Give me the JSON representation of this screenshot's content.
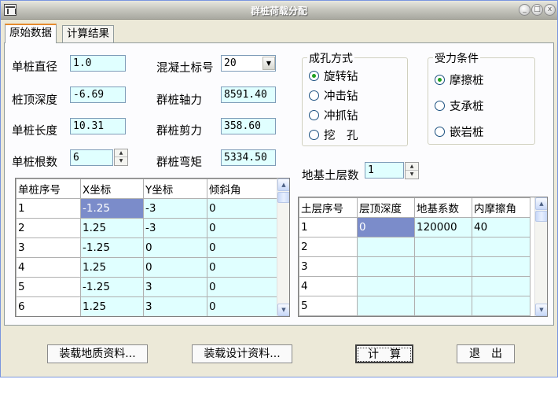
{
  "window": {
    "title": "群桩荷载分配",
    "controls": [
      "_",
      "□",
      "x"
    ]
  },
  "tabs": [
    {
      "label": "原始数据",
      "active": true
    },
    {
      "label": "计算结果",
      "active": false
    }
  ],
  "pile": {
    "diameter_label": "单桩直径",
    "diameter": "1.0",
    "top_depth_label": "桩顶深度",
    "top_depth": "-6.69",
    "length_label": "单桩长度",
    "length": "10.31",
    "count_label": "单桩根数",
    "count": "6"
  },
  "group": {
    "concrete_label": "混凝土标号",
    "concrete": "20",
    "axial_label": "群桩轴力",
    "axial": "8591.40",
    "shear_label": "群桩剪力",
    "shear": "358.60",
    "moment_label": "群桩弯矩",
    "moment": "5334.50"
  },
  "hole_method": {
    "title": "成孔方式",
    "options": [
      "旋转钻",
      "冲击钻",
      "冲抓钻",
      "挖　孔"
    ],
    "selected": 0
  },
  "load_condition": {
    "title": "受力条件",
    "options": [
      "摩擦桩",
      "支承桩",
      "嵌岩桩"
    ],
    "selected": 0
  },
  "soil": {
    "layers_label": "地基土层数",
    "layers": "1"
  },
  "pile_table": {
    "headers": [
      "单桩序号",
      "X坐标",
      "Y坐标",
      "倾斜角"
    ],
    "rows": [
      [
        "1",
        "-1.25",
        "-3",
        "0"
      ],
      [
        "2",
        "1.25",
        "-3",
        "0"
      ],
      [
        "3",
        "-1.25",
        "0",
        "0"
      ],
      [
        "4",
        "1.25",
        "0",
        "0"
      ],
      [
        "5",
        "-1.25",
        "3",
        "0"
      ],
      [
        "6",
        "1.25",
        "3",
        "0"
      ]
    ]
  },
  "soil_table": {
    "headers": [
      "土层序号",
      "层顶深度",
      "地基系数",
      "内摩擦角"
    ],
    "rows": [
      [
        "1",
        "0",
        "120000",
        "40"
      ],
      [
        "2",
        "",
        "",
        ""
      ],
      [
        "3",
        "",
        "",
        ""
      ],
      [
        "4",
        "",
        "",
        ""
      ],
      [
        "5",
        "",
        "",
        ""
      ]
    ]
  },
  "buttons": {
    "load_geo": "装载地质资料...",
    "load_design": "装载设计资料...",
    "calc": "计　算",
    "exit": "退　出"
  }
}
